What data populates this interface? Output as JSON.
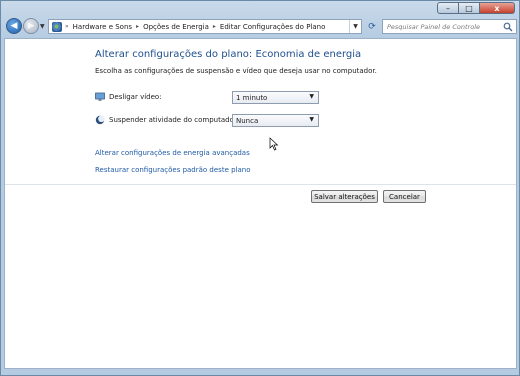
{
  "window": {
    "caption": {
      "minimize": "–",
      "maximize": "□",
      "close": "x"
    }
  },
  "nav": {
    "back_icon": "arrow-left-icon",
    "forward_icon": "arrow-right-icon",
    "address_icon": "control-panel-icon",
    "breadcrumbs": [
      {
        "label": "Hardware e Sons"
      },
      {
        "label": "Opções de Energia"
      },
      {
        "label": "Editar Configurações do Plano"
      }
    ],
    "search_placeholder": "Pesquisar Painel de Controle"
  },
  "main": {
    "title": "Alterar configurações do plano: Economia de energia",
    "subtitle": "Escolha as configurações de suspensão e vídeo que deseja usar no computador.",
    "settings": [
      {
        "label": "Desligar vídeo:",
        "value": "1 minuto",
        "icon": "monitor-icon"
      },
      {
        "label": "Suspender atividade do computador:",
        "value": "Nunca",
        "icon": "moon-sleep-icon"
      }
    ],
    "links": {
      "advanced": "Alterar configurações de energia avançadas",
      "restore": "Restaurar configurações padrão deste plano"
    },
    "buttons": {
      "save": "Salvar alterações",
      "cancel": "Cancelar"
    }
  }
}
